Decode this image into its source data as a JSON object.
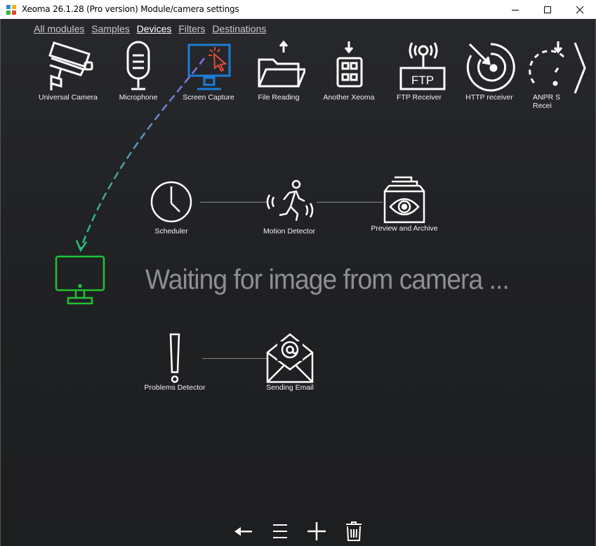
{
  "window": {
    "title": "Xeoma 26.1.28 (Pro version) Module/camera settings",
    "minimize_glyph": "–",
    "maximize_glyph": "□",
    "close_glyph": "✕"
  },
  "tabs": [
    {
      "label": "All modules",
      "active": false
    },
    {
      "label": "Samples",
      "active": false
    },
    {
      "label": "Devices",
      "active": true
    },
    {
      "label": "Filters",
      "active": false
    },
    {
      "label": "Destinations",
      "active": false
    }
  ],
  "modules": [
    {
      "label": "Universal Camera",
      "icon": "cctv-camera-icon"
    },
    {
      "label": "Microphone",
      "icon": "microphone-icon"
    },
    {
      "label": "Screen Capture",
      "icon": "screen-capture-icon"
    },
    {
      "label": "File Reading",
      "icon": "folder-upload-icon"
    },
    {
      "label": "Another Xeoma",
      "icon": "another-xeoma-icon"
    },
    {
      "label": "FTP Receiver",
      "icon": "ftp-receiver-icon"
    },
    {
      "label": "HTTP receiver",
      "icon": "http-receiver-icon"
    },
    {
      "label": "ANPR S Recei",
      "icon": "anpr-icon"
    }
  ],
  "chain": {
    "scheduler": "Scheduler",
    "motion": "Motion Detector",
    "preview": "Preview and Archive",
    "problems": "Problems Detector",
    "email": "Sending Email"
  },
  "status_text": "Waiting for image from camera ...",
  "toolbar": [
    "back-arrow-icon",
    "menu-icon",
    "add-icon",
    "trash-icon"
  ],
  "colors": {
    "accent_blue": "#1c7ed6",
    "dropped_green": "#22c232",
    "drag_gradient_start": "#8a6cf0",
    "drag_gradient_end": "#26c07a"
  }
}
